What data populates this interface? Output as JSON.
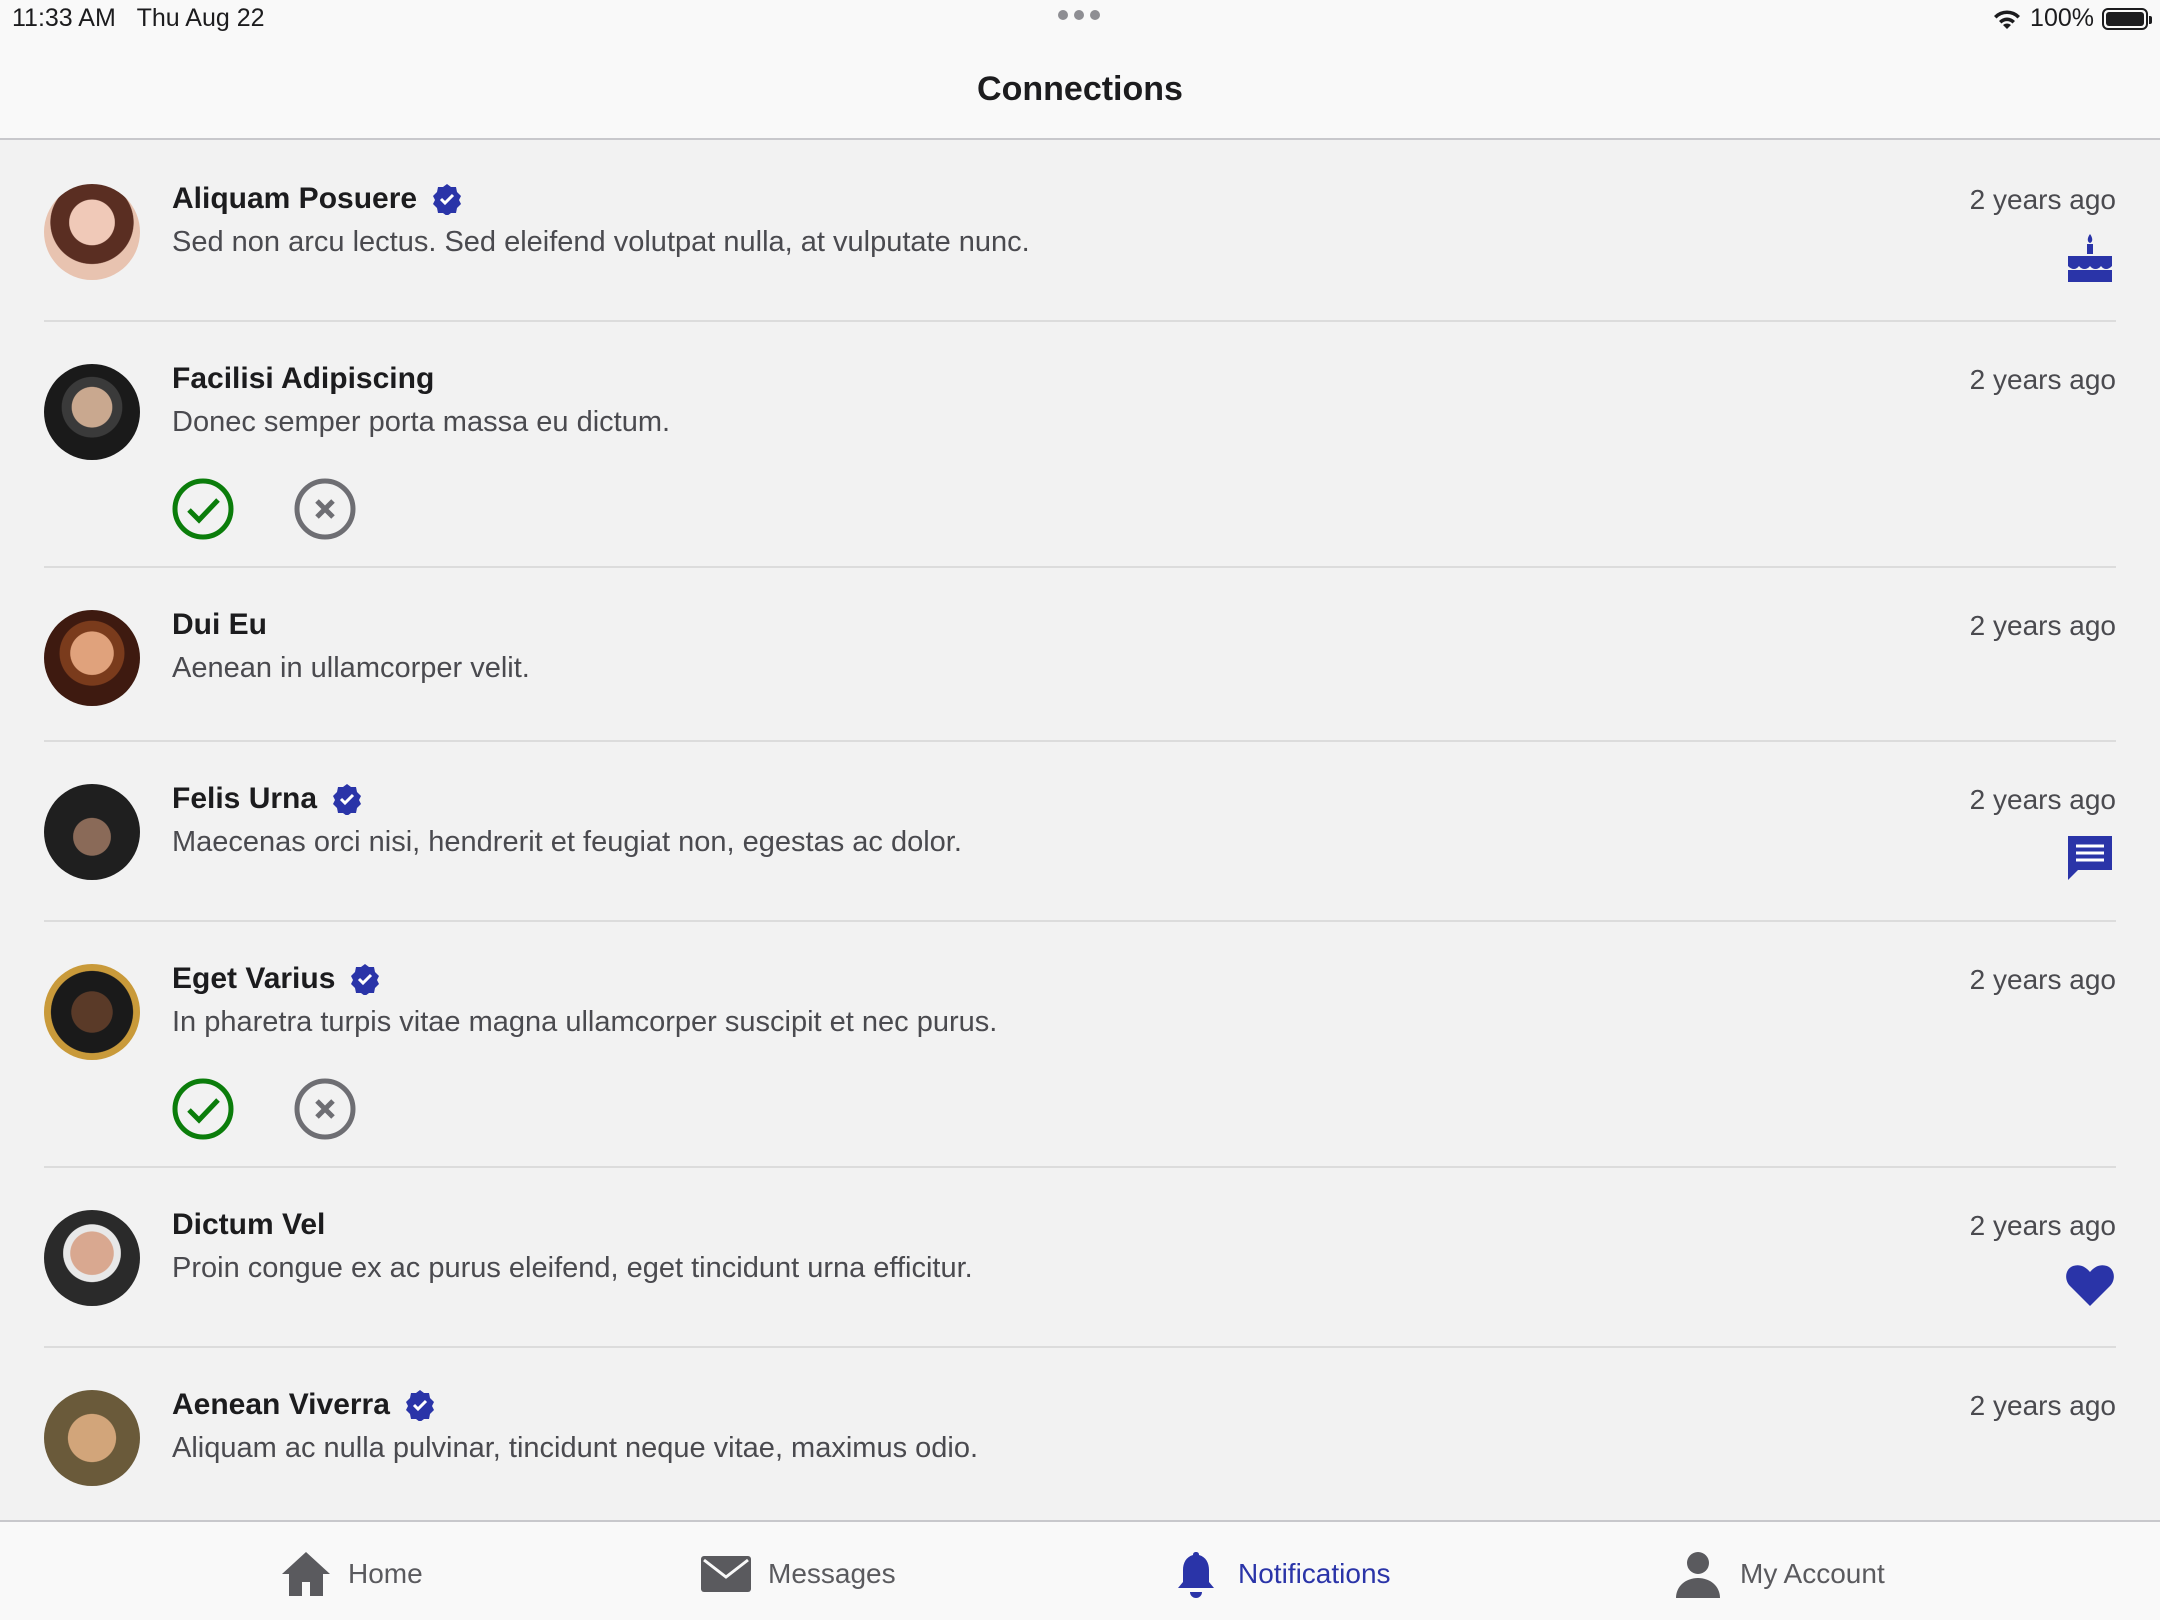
{
  "status_bar": {
    "time": "11:33 AM",
    "date": "Thu Aug 22",
    "battery": "100%"
  },
  "header": {
    "title": "Connections"
  },
  "colors": {
    "accent": "#2a34a8",
    "accept": "#0b7d0b",
    "decline": "#6e6e73"
  },
  "rows": [
    {
      "name": "Aliquam Posuere",
      "verified": true,
      "message": "Sed non arcu lectus. Sed eleifend volutpat nulla, at vulputate nunc.",
      "time": "2 years ago",
      "icon": "birthday-cake-icon",
      "actions": false
    },
    {
      "name": "Facilisi Adipiscing",
      "verified": false,
      "message": "Donec semper porta massa eu dictum.",
      "time": "2 years ago",
      "icon": "",
      "actions": true
    },
    {
      "name": "Dui Eu",
      "verified": false,
      "message": "Aenean in ullamcorper velit.",
      "time": "2 years ago",
      "icon": "",
      "actions": false
    },
    {
      "name": "Felis Urna",
      "verified": true,
      "message": "Maecenas orci nisi, hendrerit et feugiat non, egestas ac dolor.",
      "time": "2 years ago",
      "icon": "message-icon",
      "actions": false
    },
    {
      "name": "Eget Varius",
      "verified": true,
      "message": "In pharetra turpis vitae magna ullamcorper suscipit et nec purus.",
      "time": "2 years ago",
      "icon": "",
      "actions": true
    },
    {
      "name": "Dictum Vel",
      "verified": false,
      "message": "Proin congue ex ac purus eleifend, eget tincidunt urna efficitur.",
      "time": "2 years ago",
      "icon": "heart-icon",
      "actions": false
    },
    {
      "name": "Aenean Viverra",
      "verified": true,
      "message": "Aliquam ac nulla pulvinar, tincidunt neque vitae, maximus odio.",
      "time": "2 years ago",
      "icon": "",
      "actions": false
    }
  ],
  "tabs": [
    {
      "label": "Home",
      "icon": "home-icon",
      "active": false
    },
    {
      "label": "Messages",
      "icon": "envelope-icon",
      "active": false
    },
    {
      "label": "Notifications",
      "icon": "bell-icon",
      "active": true
    },
    {
      "label": "My Account",
      "icon": "person-icon",
      "active": false
    }
  ]
}
